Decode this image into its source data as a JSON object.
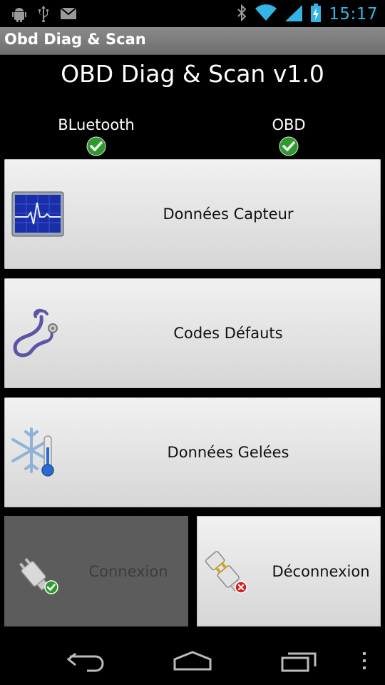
{
  "statusbar": {
    "time": "15:17",
    "icons": [
      "android-debug-icon",
      "usb-icon",
      "mail-icon",
      "bluetooth-icon",
      "wifi-icon",
      "signal-icon",
      "battery-charging-icon"
    ],
    "accent": "#33b5e5"
  },
  "actionbar": {
    "title": "Obd Diag & Scan"
  },
  "app": {
    "title": "OBD Diag & Scan v1.0"
  },
  "status": {
    "bluetooth_label": "BLuetooth",
    "obd_label": "OBD"
  },
  "buttons": {
    "sensor_data": "Données Capteur",
    "fault_codes": "Codes Défauts",
    "freeze_frame": "Données Gelées",
    "connect": "Connexion",
    "disconnect": "Déconnexion"
  },
  "navbar": {
    "icons": [
      "back-icon",
      "home-icon",
      "recent-apps-icon",
      "overflow-menu-icon"
    ]
  }
}
